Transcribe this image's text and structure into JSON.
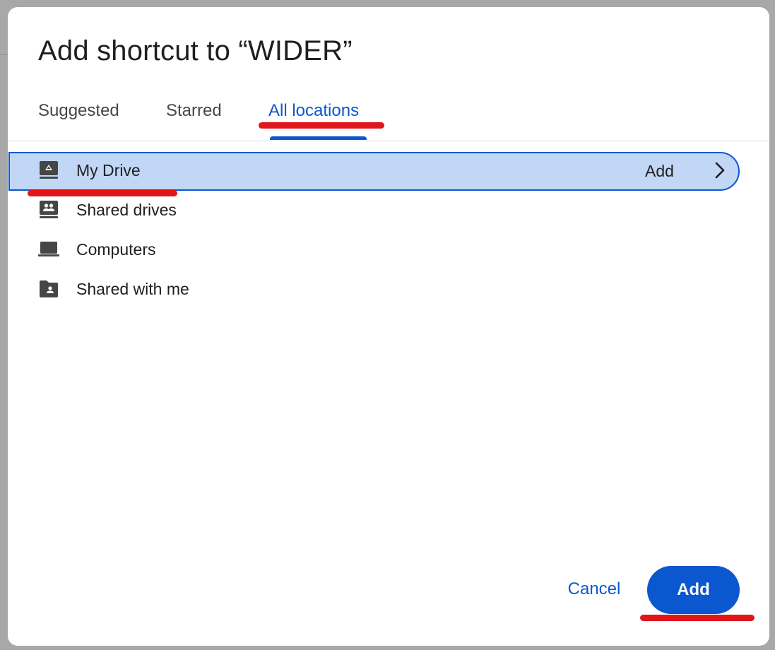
{
  "dialog": {
    "title": "Add shortcut to “WIDER”"
  },
  "tabs": [
    {
      "label": "Suggested",
      "active": false
    },
    {
      "label": "Starred",
      "active": false
    },
    {
      "label": "All locations",
      "active": true
    }
  ],
  "locations": [
    {
      "label": "My Drive",
      "icon": "my-drive-icon",
      "selected": true,
      "action_label": "Add"
    },
    {
      "label": "Shared drives",
      "icon": "shared-drives-icon",
      "selected": false
    },
    {
      "label": "Computers",
      "icon": "computer-icon",
      "selected": false
    },
    {
      "label": "Shared with me",
      "icon": "shared-with-me-icon",
      "selected": false
    }
  ],
  "footer": {
    "cancel_label": "Cancel",
    "add_label": "Add"
  },
  "colors": {
    "accent": "#0b57d0",
    "selected_bg": "#c2d7f5",
    "annotation": "#e0161b"
  }
}
